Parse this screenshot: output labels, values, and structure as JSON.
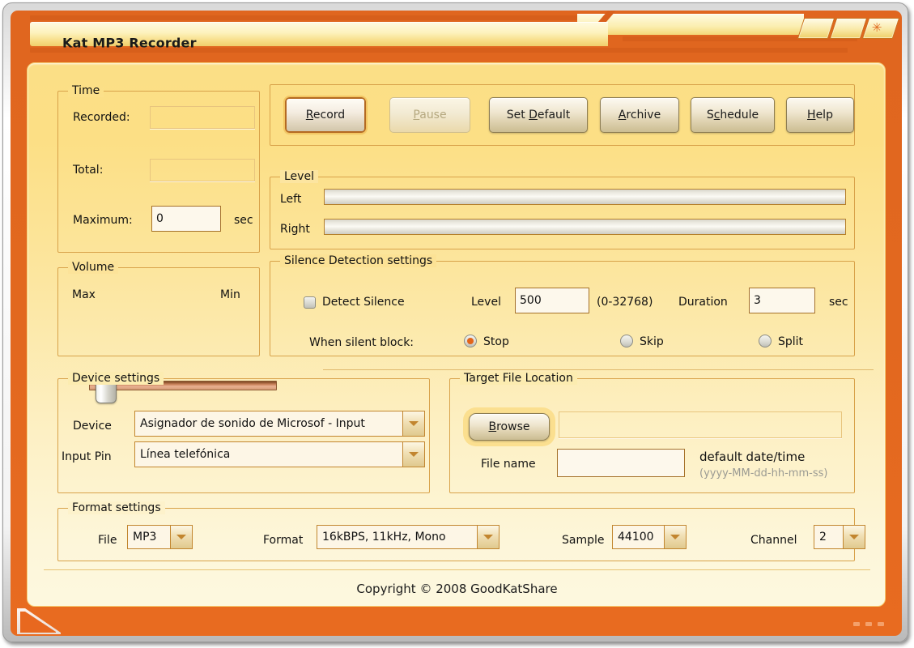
{
  "window": {
    "title": "Kat MP3 Recorder",
    "controls": [
      {
        "name": "minimize",
        "glyph": ""
      },
      {
        "name": "maximize",
        "glyph": ""
      },
      {
        "name": "close",
        "glyph": "✳"
      }
    ]
  },
  "time": {
    "legend": "Time",
    "recorded_label": "Recorded:",
    "recorded_value": "",
    "total_label": "Total:",
    "total_value": "",
    "maximum_label": "Maximum:",
    "maximum_value": "0",
    "maximum_unit": "sec"
  },
  "actions": {
    "record": {
      "label": "Record",
      "mnemonic": "R",
      "state": "focused"
    },
    "pause": {
      "label": "Pause",
      "mnemonic": "P",
      "state": "disabled"
    },
    "set_default": {
      "label": "Set Default",
      "mnemonic": "D",
      "state": "normal"
    },
    "archive": {
      "label": "Archive",
      "mnemonic": "A",
      "state": "normal"
    },
    "schedule": {
      "label": "Schedule",
      "mnemonic": "c",
      "state": "normal"
    },
    "help": {
      "label": "Help",
      "mnemonic": "H",
      "state": "normal"
    }
  },
  "level": {
    "legend": "Level",
    "left_label": "Left",
    "right_label": "Right",
    "left_value": 0,
    "right_value": 0
  },
  "volume": {
    "legend": "Volume",
    "max_label": "Max",
    "min_label": "Min",
    "position_percent": 4
  },
  "silence": {
    "legend": "Silence Detection settings",
    "detect_label": "Detect Silence",
    "detect_checked": false,
    "level_label": "Level",
    "level_value": "500",
    "level_range": "(0-32768)",
    "duration_label": "Duration",
    "duration_value": "3",
    "duration_unit": "sec",
    "when_silent_label": "When silent block:",
    "options": [
      {
        "label": "Stop",
        "selected": true
      },
      {
        "label": "Skip",
        "selected": false
      },
      {
        "label": "Split",
        "selected": false
      }
    ]
  },
  "device": {
    "legend": "Device settings",
    "device_label": "Device",
    "device_value": "Asignador de sonido de Microsof - Input",
    "input_pin_label": "Input Pin",
    "input_pin_value": "Línea telefónica"
  },
  "target": {
    "legend": "Target File Location",
    "browse_label": "Browse",
    "browse_mnemonic": "B",
    "path_value": "",
    "file_name_label": "File name",
    "file_name_value": "",
    "default_hint_title": "default date/time",
    "default_hint_format": "(yyyy-MM-dd-hh-mm-ss)"
  },
  "format": {
    "legend": "Format settings",
    "file_label": "File",
    "file_value": "MP3",
    "format_label": "Format",
    "format_value": "16kBPS, 11kHz, Mono",
    "sample_label": "Sample",
    "sample_value": "44100",
    "channel_label": "Channel",
    "channel_value": "2"
  },
  "footer": {
    "copyright": "Copyright © 2008 GoodKatShare"
  },
  "colors": {
    "chassis_orange": "#e2681f",
    "panel_yellow": "#fcdf85",
    "accent": "#e2641a",
    "field_border": "#c2862f"
  }
}
